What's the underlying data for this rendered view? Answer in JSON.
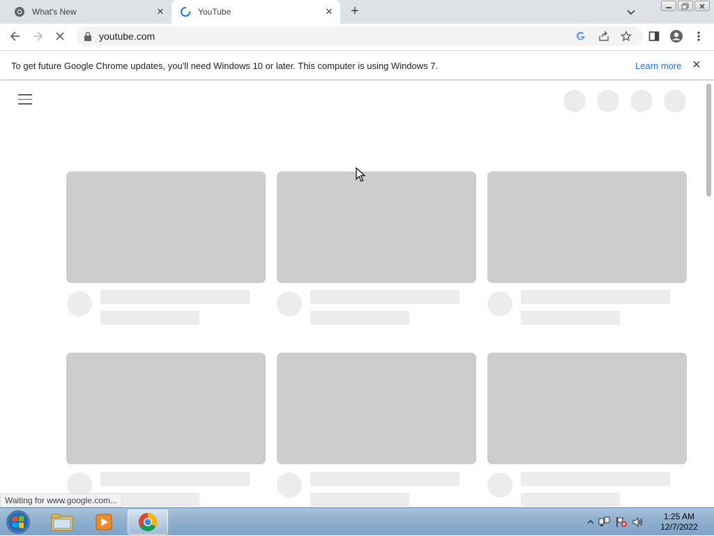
{
  "browser": {
    "tabs": [
      {
        "title": "What's New",
        "close": "✕"
      },
      {
        "title": "YouTube",
        "close": "✕"
      }
    ],
    "new_tab": "+",
    "url": "youtube.com",
    "colors": {
      "tabstrip": "#dee1e6",
      "omnibox": "#f1f3f4",
      "link": "#1a73e8"
    }
  },
  "infobar": {
    "message": "To get future Google Chrome updates, you'll need Windows 10 or later. This computer is using Windows 7.",
    "link": "Learn more",
    "close": "✕"
  },
  "page": {
    "state": "loading-skeleton",
    "skeleton_cards": 6
  },
  "status": {
    "text": "Waiting for www.google.com..."
  },
  "taskbar": {
    "apps": [
      "start-orb",
      "windows-explorer",
      "media-player",
      "google-chrome"
    ],
    "clock": {
      "time": "1:25 AM",
      "date": "12/7/2022"
    }
  }
}
